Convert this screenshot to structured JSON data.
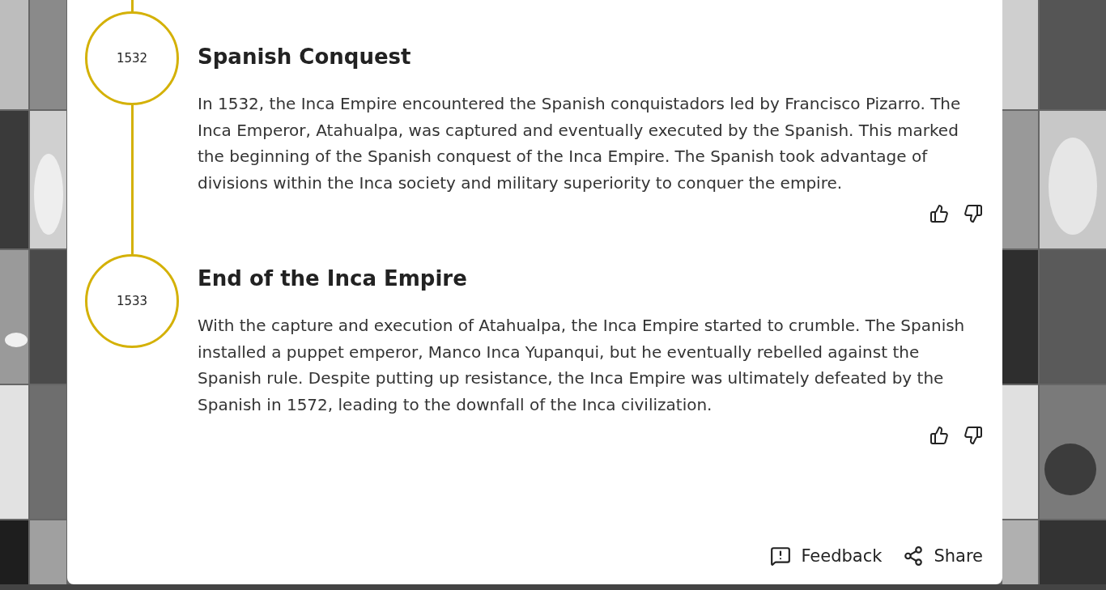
{
  "timeline": [
    {
      "year": "1532",
      "title": "Spanish Conquest",
      "text": "In 1532, the Inca Empire encountered the Spanish conquistadors led by Francisco Pizarro. The Inca Emperor, Atahualpa, was captured and eventually executed by the Spanish. This marked the beginning of the Spanish conquest of the Inca Empire. The Spanish took advantage of divisions within the Inca society and military superiority to conquer the empire."
    },
    {
      "year": "1533",
      "title": "End of the Inca Empire",
      "text": "With the capture and execution of Atahualpa, the Inca Empire started to crumble. The Spanish installed a puppet emperor, Manco Inca Yupanqui, but he eventually rebelled against the Spanish rule. Despite putting up resistance, the Inca Empire was ultimately defeated by the Spanish in 1572, leading to the downfall of the Inca civilization."
    }
  ],
  "footer": {
    "feedback": "Feedback",
    "share": "Share"
  }
}
